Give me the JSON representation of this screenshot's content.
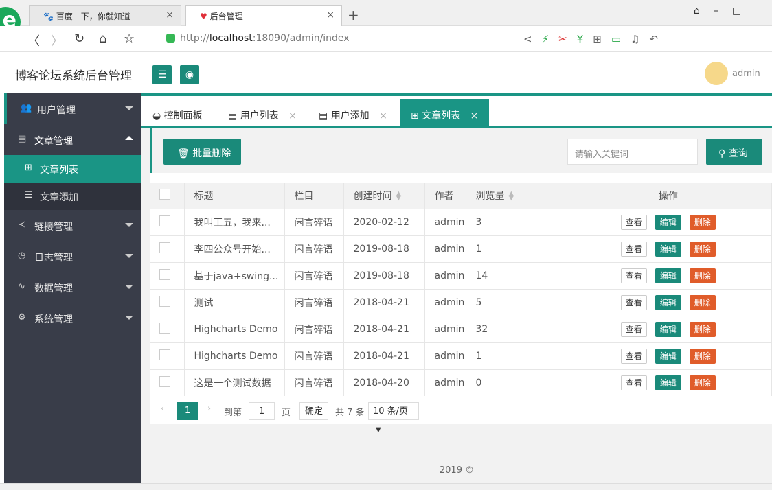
{
  "browser": {
    "tabs": [
      {
        "label": "百度一下，你就知道",
        "close": "×"
      },
      {
        "label": "后台管理",
        "close": "×"
      }
    ],
    "new_tab": "+",
    "url_prefix": "http://",
    "url_host": "localhost",
    "url_rest": ":18090/admin/index"
  },
  "header": {
    "title": "博客论坛系统后台管理",
    "user": "admin"
  },
  "sidebar": {
    "menus": [
      {
        "label": "用户管理",
        "icon": "users-icon"
      },
      {
        "label": "文章管理",
        "icon": "article-icon"
      },
      {
        "label": "链接管理",
        "icon": "share-icon"
      },
      {
        "label": "日志管理",
        "icon": "log-icon"
      },
      {
        "label": "数据管理",
        "icon": "pulse-icon"
      },
      {
        "label": "系统管理",
        "icon": "gears-icon"
      }
    ],
    "submenus": [
      {
        "label": "文章列表"
      },
      {
        "label": "文章添加"
      }
    ]
  },
  "page_tabs": [
    {
      "label": "控制面板"
    },
    {
      "label": "用户列表",
      "close": "×"
    },
    {
      "label": "用户添加",
      "close": "×"
    },
    {
      "label": "文章列表",
      "close": "×"
    }
  ],
  "toolbar": {
    "batch_delete": "批量删除",
    "search_placeholder": "请输入关键词",
    "search_button": "查询"
  },
  "table": {
    "headers": [
      "标题",
      "栏目",
      "创建时间",
      "作者",
      "浏览量",
      "操作"
    ],
    "rows": [
      {
        "title": "我叫王五，我来...",
        "category": "闲言碎语",
        "date": "2020-02-12",
        "author": "admin",
        "views": "3"
      },
      {
        "title": "李四公众号开始...",
        "category": "闲言碎语",
        "date": "2019-08-18",
        "author": "admin",
        "views": "1"
      },
      {
        "title": "基于java+swing...",
        "category": "闲言碎语",
        "date": "2019-08-18",
        "author": "admin",
        "views": "14"
      },
      {
        "title": "测试",
        "category": "闲言碎语",
        "date": "2018-04-21",
        "author": "admin",
        "views": "5"
      },
      {
        "title": "Highcharts Demo",
        "category": "闲言碎语",
        "date": "2018-04-21",
        "author": "admin",
        "views": "32"
      },
      {
        "title": "Highcharts Demo",
        "category": "闲言碎语",
        "date": "2018-04-21",
        "author": "admin",
        "views": "1"
      },
      {
        "title": "这是一个测试数据",
        "category": "闲言碎语",
        "date": "2018-04-20",
        "author": "admin",
        "views": "0"
      }
    ],
    "actions": {
      "view": "查看",
      "edit": "编辑",
      "delete": "删除"
    }
  },
  "pager": {
    "current": "1",
    "goto_label": "到第",
    "goto_value": "1",
    "page_unit": "页",
    "confirm": "确定",
    "total": "共 7 条",
    "page_size": "10 条/页"
  },
  "footer": "2019 ©",
  "colors": {
    "accent": "#1a8a7a",
    "danger": "#e05c2a",
    "sidebar": "#393d49"
  }
}
